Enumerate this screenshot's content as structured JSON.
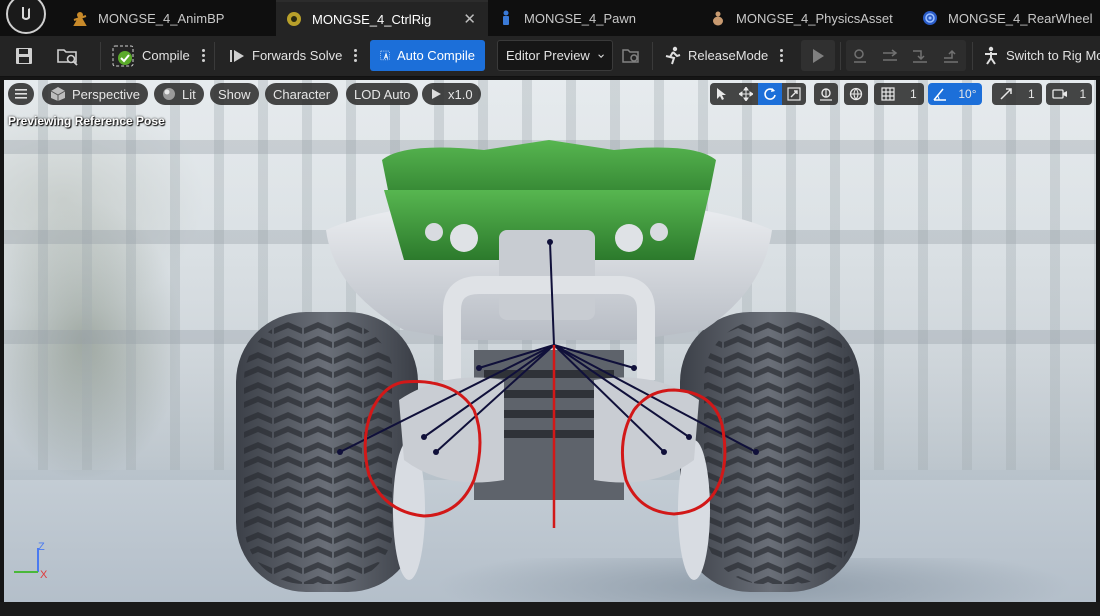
{
  "tabs": [
    {
      "label": "MONGSE_4_AnimBP",
      "icon": "anim-blueprint-icon",
      "active": false
    },
    {
      "label": "MONGSE_4_CtrlRig",
      "icon": "control-rig-icon",
      "active": true
    },
    {
      "label": "MONGSE_4_Pawn",
      "icon": "pawn-icon",
      "active": false
    },
    {
      "label": "MONGSE_4_PhysicsAsset",
      "icon": "physics-asset-icon",
      "active": false
    },
    {
      "label": "MONGSE_4_RearWheel",
      "icon": "wheel-blueprint-icon",
      "active": false
    }
  ],
  "tab_close": "✕",
  "toolbar": {
    "compile": "Compile",
    "forwards_solve": "Forwards Solve",
    "auto_compile": "Auto Compile",
    "editor_preview": "Editor Preview",
    "release_mode": "ReleaseMode",
    "switch_to_rig": "Switch to Rig Mo"
  },
  "viewport": {
    "perspective": "Perspective",
    "lit": "Lit",
    "show": "Show",
    "character": "Character",
    "lod": "LOD Auto",
    "speed": "x1.0",
    "status": "Previewing Reference Pose",
    "grid_size": "1",
    "rotation_snap": "10°",
    "scale_snap": "1",
    "camera_speed": "1",
    "axis_z": "Z",
    "axis_x": "X"
  },
  "colors": {
    "accent": "#1c6fd9",
    "annotation": "#d21818",
    "bones": "#0e0e3c"
  }
}
